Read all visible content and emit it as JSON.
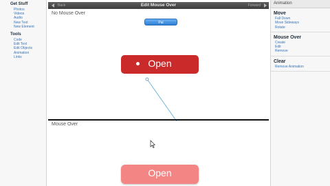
{
  "left_sidebar": {
    "get_stuff": {
      "title": "Get Stuff",
      "items": [
        "Photos",
        "Videos",
        "Audio",
        "New Text",
        "New Element"
      ]
    },
    "tools": {
      "title": "Tools",
      "items": [
        "Code",
        "Edit Text",
        "Edit Objects",
        "Animation",
        "Links"
      ]
    }
  },
  "window": {
    "title": "Edit Mouse Over",
    "nav_left": "Back",
    "nav_right": "Forward",
    "top_panel_label": "No Mouse Over",
    "small_button_label": "Pal",
    "open_button_label": "Open",
    "bottom_panel_label": "Mouse Over",
    "open_button_hover_label": "Open"
  },
  "right_sidebar": {
    "header": "Animation",
    "move": {
      "title": "Move",
      "items": [
        "Fall Down",
        "Move Sideways",
        "Rotate"
      ]
    },
    "mouse_over": {
      "title": "Mouse Over",
      "items": [
        "Create",
        "Edit",
        "Remove"
      ]
    },
    "clear": {
      "title": "Clear",
      "items": [
        "Remove Animation"
      ]
    }
  },
  "colors": {
    "open_normal": "#cb2a2a",
    "open_hover": "#f48585",
    "link": "#3a74b5",
    "titlebar": "#4a4a4a"
  }
}
